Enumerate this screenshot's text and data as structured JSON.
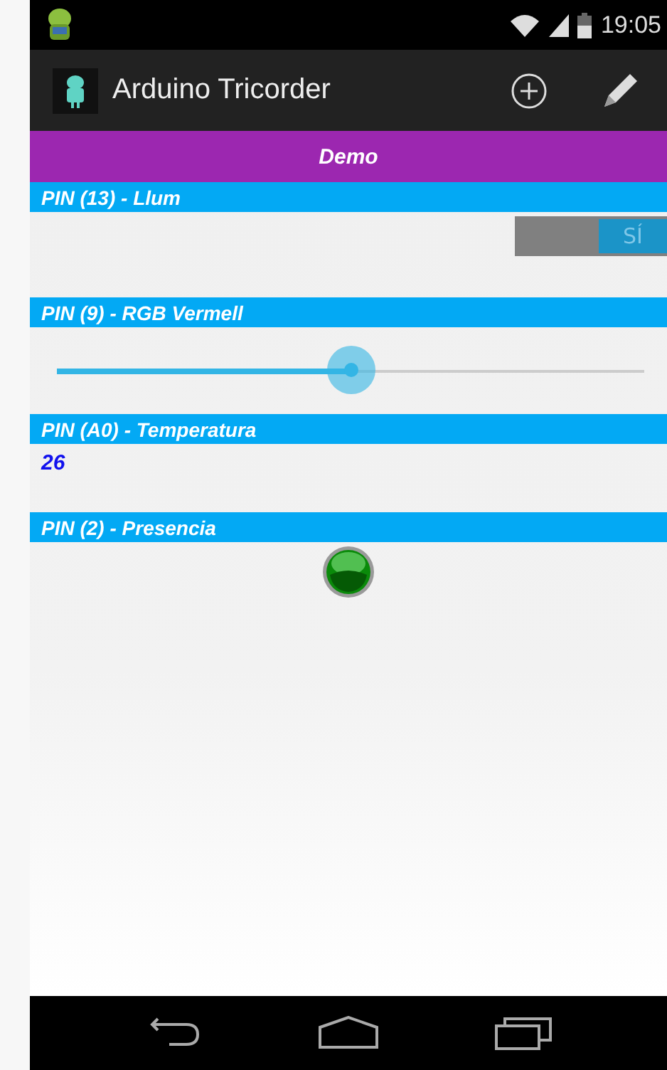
{
  "status_bar": {
    "time": "19:05"
  },
  "action_bar": {
    "title": "Arduino Tricorder"
  },
  "profile": {
    "title": "Demo"
  },
  "pins": [
    {
      "label": "PIN (13) - Llum",
      "kind": "switch",
      "on": true,
      "switch_text": "SÍ"
    },
    {
      "label": "PIN (9) - RGB Vermell",
      "kind": "slider",
      "level": 0.5
    },
    {
      "label": "PIN (A0) - Temperatura",
      "kind": "value",
      "value": "26"
    },
    {
      "label": "PIN (2) - Presencia",
      "kind": "led",
      "on": true
    }
  ]
}
